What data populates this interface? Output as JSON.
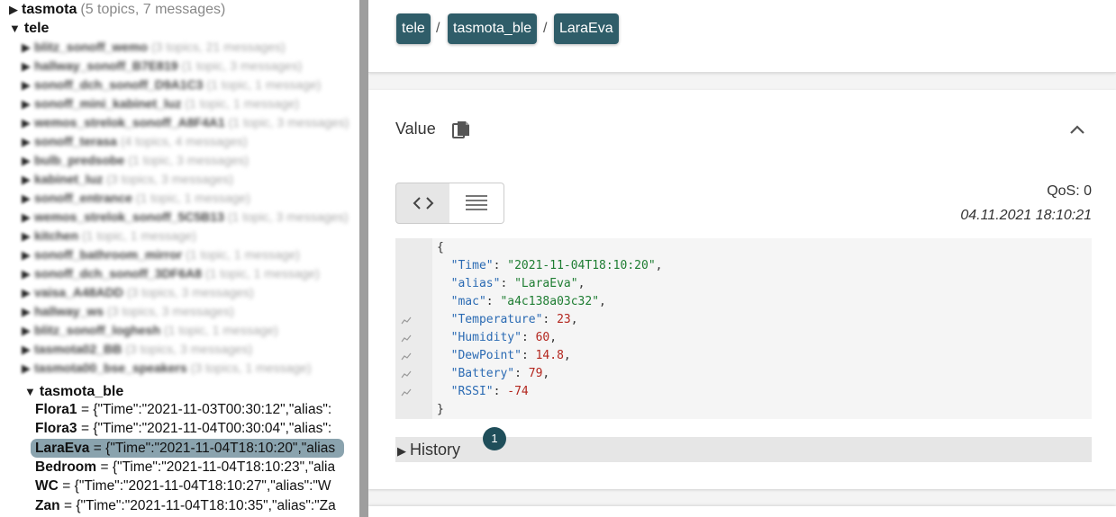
{
  "tree": {
    "root": {
      "label": "tasmota",
      "meta": "(5 topics, 7 messages)"
    },
    "tele": {
      "label": "tele"
    },
    "hidden_items": [
      {
        "label": "blitz_sonoff_wemo",
        "meta": "(3 topics, 21 messages)"
      },
      {
        "label": "hallway_sonoff_B7E819",
        "meta": "(1 topic, 3 messages)"
      },
      {
        "label": "sonoff_dch_sonoff_D9A1C3",
        "meta": "(1 topic, 1 message)"
      },
      {
        "label": "sonoff_mini_kabinet_luz",
        "meta": "(1 topic, 1 message)"
      },
      {
        "label": "wemos_strelok_sonoff_A8F4A1",
        "meta": "(1 topic, 3 messages)"
      },
      {
        "label": "sonoff_terasa",
        "meta": "(4 topics, 4 messages)"
      },
      {
        "label": "bulb_predsobe",
        "meta": "(1 topic, 3 messages)"
      },
      {
        "label": "kabinet_luz",
        "meta": "(3 topics, 3 messages)"
      },
      {
        "label": "sonoff_entrance",
        "meta": "(1 topic, 1 message)"
      },
      {
        "label": "wemos_strelok_sonoff_5C5B13",
        "meta": "(1 topic, 3 messages)"
      },
      {
        "label": "kitchen",
        "meta": "(1 topic, 1 message)"
      },
      {
        "label": "sonoff_bathroom_mirror",
        "meta": "(1 topic, 1 message)"
      },
      {
        "label": "sonoff_dch_sonoff_3DF6A8",
        "meta": "(1 topic, 1 message)"
      },
      {
        "label": "vaisa_A48ADD",
        "meta": "(3 topics, 3 messages)"
      },
      {
        "label": "hallway_ws",
        "meta": "(3 topics, 3 messages)"
      },
      {
        "label": "blitz_sonoff_loghesh",
        "meta": "(1 topic, 1 message)"
      },
      {
        "label": "tasmota02_BB",
        "meta": "(3 topics, 3 messages)"
      },
      {
        "label": "tasmota00_bse_speakers",
        "meta": "(3 topics, 1 message)"
      }
    ],
    "tasmota_ble": {
      "label": "tasmota_ble"
    },
    "leaves": [
      {
        "key": "Flora1",
        "val": "= {\"Time\":\"2021-11-03T00:30:12\",\"alias\":"
      },
      {
        "key": "Flora3",
        "val": "= {\"Time\":\"2021-11-04T00:30:04\",\"alias\":"
      },
      {
        "key": "LaraEva",
        "val": "= {\"Time\":\"2021-11-04T18:10:20\",\"alias"
      },
      {
        "key": "Bedroom",
        "val": "= {\"Time\":\"2021-11-04T18:10:23\",\"alia"
      },
      {
        "key": "WC",
        "val": "= {\"Time\":\"2021-11-04T18:10:27\",\"alias\":\"W"
      },
      {
        "key": "Zan",
        "val": "= {\"Time\":\"2021-11-04T18:10:35\",\"alias\":\"Za"
      }
    ]
  },
  "breadcrumb": {
    "items": [
      "tele",
      "tasmota_ble",
      "LaraEva"
    ],
    "separator": "/"
  },
  "value_panel": {
    "title": "Value",
    "qos": "QoS: 0",
    "timestamp": "04.11.2021 18:10:21",
    "code": {
      "open": "{",
      "close": "}",
      "fields": [
        {
          "k": "\"Time\"",
          "v": "\"2021-11-04T18:10:20\"",
          "type": "s",
          "chart": false
        },
        {
          "k": "\"alias\"",
          "v": "\"LaraEva\"",
          "type": "s",
          "chart": false
        },
        {
          "k": "\"mac\"",
          "v": "\"a4c138a03c32\"",
          "type": "s",
          "chart": false
        },
        {
          "k": "\"Temperature\"",
          "v": "23",
          "type": "n",
          "chart": true
        },
        {
          "k": "\"Humidity\"",
          "v": "60",
          "type": "n",
          "chart": true
        },
        {
          "k": "\"DewPoint\"",
          "v": "14.8",
          "type": "n",
          "chart": true
        },
        {
          "k": "\"Battery\"",
          "v": "79",
          "type": "n",
          "chart": true
        },
        {
          "k": "\"RSSI\"",
          "v": "-74",
          "type": "n",
          "chart": true
        }
      ]
    },
    "history": {
      "label": "History",
      "count": "1"
    }
  },
  "colors": {
    "accent": "#2f5d69",
    "selected": "#8aa3ae",
    "badge": "#1f4e5a"
  }
}
